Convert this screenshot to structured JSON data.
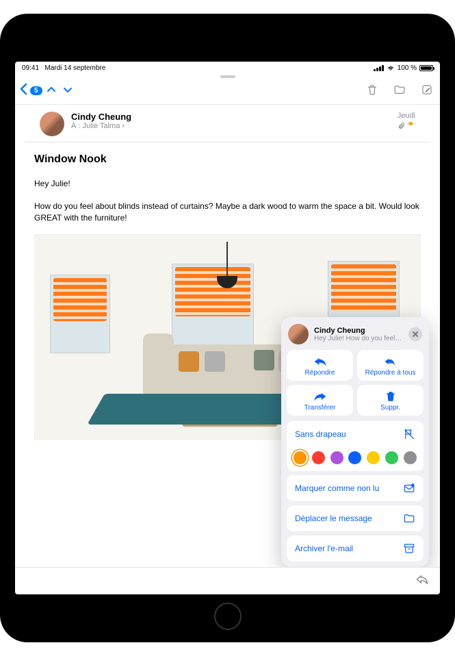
{
  "status": {
    "time": "09:41",
    "date": "Mardi 14 septembre",
    "battery_pct": "100 %"
  },
  "nav": {
    "unread_count": "5"
  },
  "header": {
    "sender": "Cindy Cheung",
    "to_prefix": "À :",
    "recipient": "Julie Talma",
    "day": "Jeudi"
  },
  "mail": {
    "subject": "Window Nook",
    "greeting": "Hey Julie!",
    "body": "How do you feel about blinds instead of curtains? Maybe a dark wood to warm the space a bit. Would look GREAT with the furniture!"
  },
  "popover": {
    "name": "Cindy Cheung",
    "preview": "Hey Julie! How do you feel ab…",
    "reply": "Répondre",
    "reply_all": "Répondre à tous",
    "forward": "Transférer",
    "delete": "Suppr.",
    "unflag": "Sans drapeau",
    "mark_unread": "Marquer comme non lu",
    "move": "Déplacer le message",
    "archive": "Archiver l'e-mail",
    "flag_colors": [
      "#ff9500",
      "#ff3b30",
      "#af52de",
      "#0a60ff",
      "#ffcc00",
      "#34c759",
      "#8e8e93"
    ]
  }
}
